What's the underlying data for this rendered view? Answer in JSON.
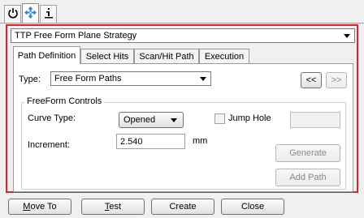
{
  "toolbar_tabs": [
    {
      "icon": "power-icon"
    },
    {
      "icon": "move-arrows-icon"
    },
    {
      "icon": "info-icon"
    }
  ],
  "strategy": {
    "selected": "TTP Free Form Plane Strategy"
  },
  "tabs": [
    {
      "label": "Path Definition",
      "active": true
    },
    {
      "label": "Select Hits",
      "active": false
    },
    {
      "label": "Scan/Hit Path",
      "active": false
    },
    {
      "label": "Execution",
      "active": false
    }
  ],
  "type_row": {
    "label": "Type:",
    "selected": "Free Form Paths",
    "prev_label": "<<",
    "next_label": ">>"
  },
  "freeform": {
    "title": "FreeForm Controls",
    "curve_type_label": "Curve Type:",
    "curve_type_value": "Opened",
    "jump_hole_label": "Jump Hole",
    "jump_hole_checked": false,
    "jump_hole_value": "",
    "increment_label": "Increment:",
    "increment_value": "2.540",
    "unit": "mm",
    "generate_label": "Generate",
    "add_path_label": "Add Path"
  },
  "bottom": {
    "move_to_label": "Move To",
    "move_to_mnemonic": "M",
    "test_label": "Test",
    "test_mnemonic": "T",
    "create_label": "Create",
    "close_label": "Close"
  },
  "colors": {
    "highlight": "#e32129",
    "arrow_icon": "#2a7fd4"
  }
}
